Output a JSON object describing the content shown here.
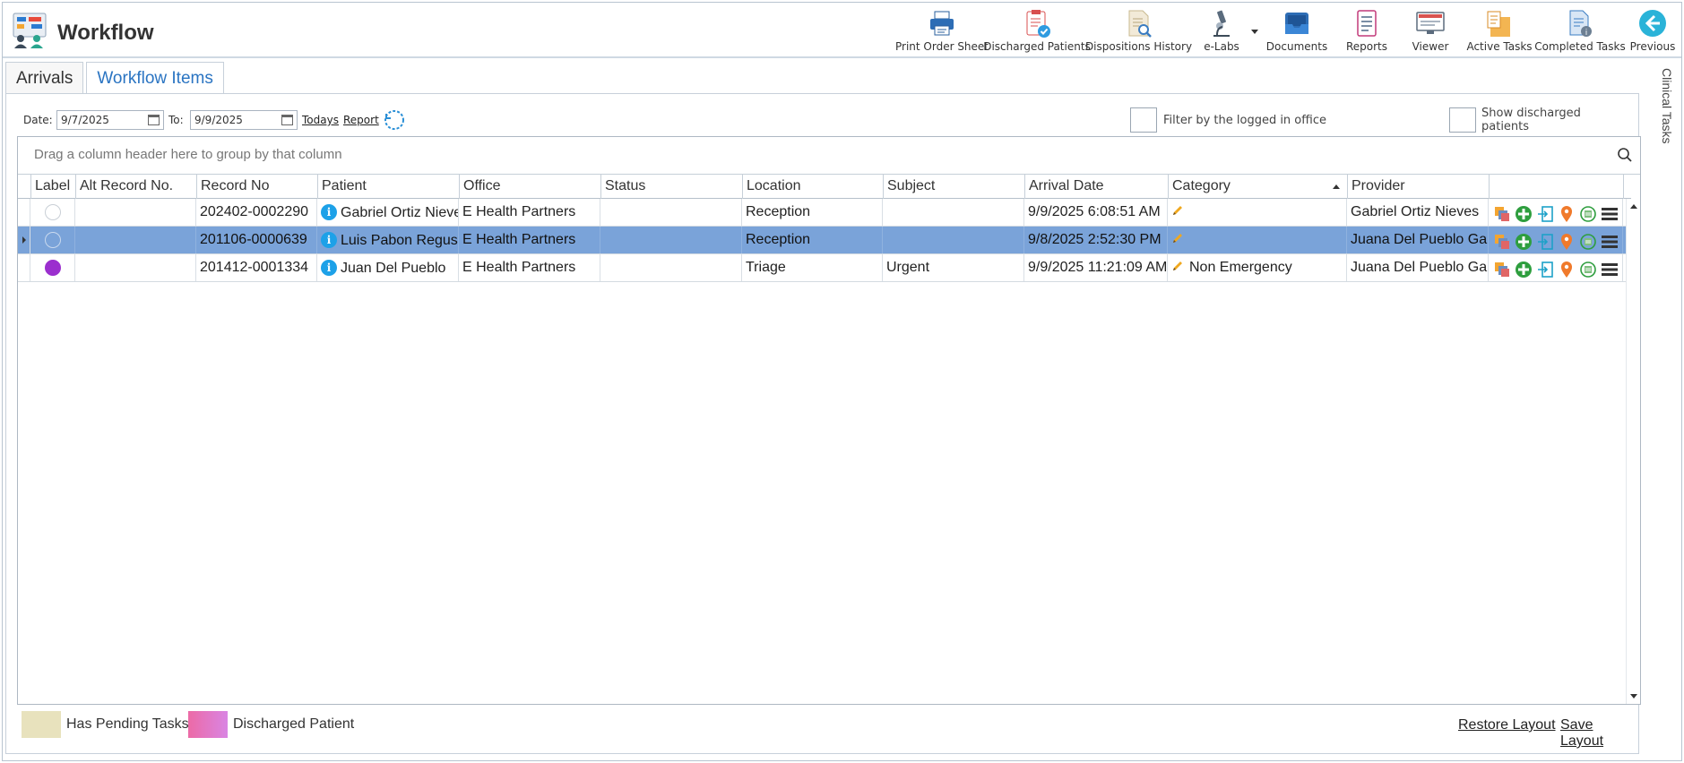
{
  "app": {
    "title": "Workflow"
  },
  "toolbar": [
    {
      "label": "Print Order Sheet",
      "icon": "printer-icon"
    },
    {
      "label": "Discharged Patients",
      "icon": "clipboard-check-icon"
    },
    {
      "label": "Dispositions History",
      "icon": "document-search-icon"
    },
    {
      "label": "e-Labs",
      "icon": "microscope-icon"
    },
    {
      "label": "Documents",
      "icon": "inbox-tray-icon"
    },
    {
      "label": "Reports",
      "icon": "report-icon"
    },
    {
      "label": "Viewer",
      "icon": "monitor-icon"
    },
    {
      "label": "Active Tasks",
      "icon": "active-tasks-icon"
    },
    {
      "label": "Completed Tasks",
      "icon": "completed-tasks-icon"
    },
    {
      "label": "Previous",
      "icon": "back-arrow-icon"
    }
  ],
  "tabs": [
    {
      "label": "Arrivals",
      "active": false
    },
    {
      "label": "Workflow Items",
      "active": true
    }
  ],
  "side_tab": {
    "label": "Clinical Tasks"
  },
  "filters": {
    "date_label": "Date:",
    "date_from": "9/7/2025",
    "to_label": "To:",
    "date_to": "9/9/2025",
    "todays_link": "Todays",
    "report_link": "Report",
    "filter_office_label": "Filter by the logged in office",
    "show_discharged_label": "Show discharged patients"
  },
  "grid": {
    "group_panel_text": "Drag a column header here to group by that column",
    "columns": [
      "Label",
      "Alt Record No.",
      "Record No",
      "Patient",
      "Office",
      "Status",
      "Location",
      "Subject",
      "Arrival Date",
      "Category",
      "Provider"
    ],
    "sorted_column": "Category",
    "rows": [
      {
        "label_color": "none",
        "alt_record": "",
        "record_no": "202402-0002290",
        "patient": "Gabriel Ortiz Nieves",
        "office": "E Health Partners",
        "status": "",
        "location": "Reception",
        "subject": "",
        "arrival_date": "9/9/2025 6:08:51 AM",
        "category": "",
        "provider": "Gabriel Ortiz Nieves",
        "selected": false
      },
      {
        "label_color": "none",
        "alt_record": "",
        "record_no": "201106-0000639",
        "patient": "Luis Pabon Regus",
        "office": "E Health Partners",
        "status": "",
        "location": "Reception",
        "subject": "",
        "arrival_date": "9/8/2025 2:52:30 PM",
        "category": "",
        "provider": "Juana Del Pueblo Garcia",
        "selected": true
      },
      {
        "label_color": "#9b2fce",
        "alt_record": "",
        "record_no": "201412-0001334",
        "patient": "Juan Del Pueblo",
        "office": "E Health Partners",
        "status": "",
        "location": "Triage",
        "subject": "Urgent",
        "arrival_date": "9/9/2025 11:21:09 AM",
        "category": "Non Emergency",
        "provider": "Juana Del Pueblo Garcia",
        "selected": false
      }
    ]
  },
  "legend": [
    {
      "label": "Has Pending Tasks",
      "color": "#e8e2bd"
    },
    {
      "label": "Discharged Patient",
      "color": "#e07ac0"
    }
  ],
  "footer": {
    "restore_layout": "Restore Layout",
    "save_layout": "Save Layout"
  },
  "colors": {
    "accent": "#2a74c2",
    "selected_row": "#7aa3d9"
  }
}
